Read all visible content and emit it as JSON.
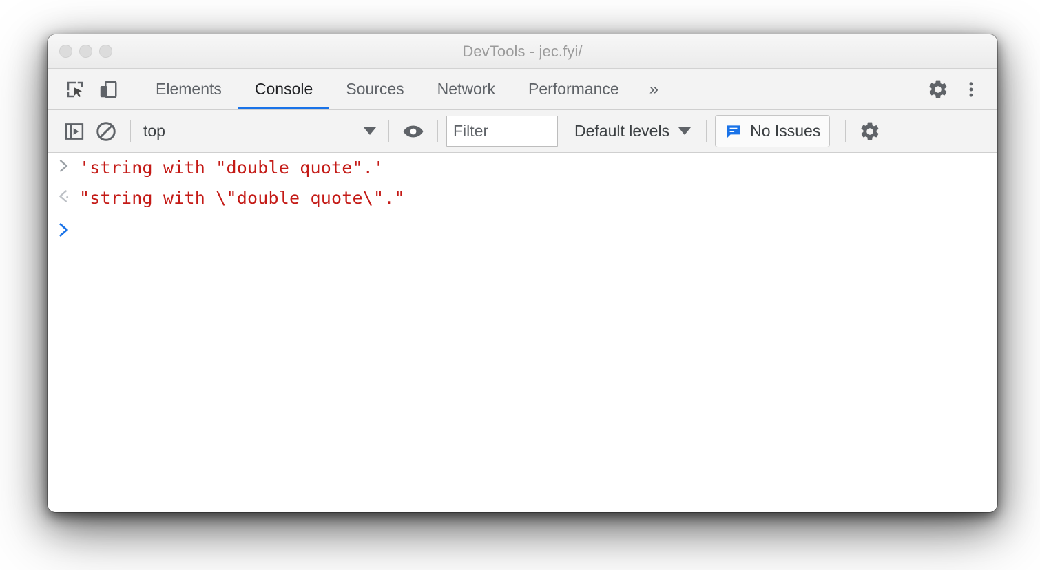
{
  "window": {
    "title": "DevTools - jec.fyi/",
    "traffic_lights": [
      "close-button",
      "minimize-button",
      "maximize-button"
    ]
  },
  "tabbar": {
    "inspect_icon": "inspect-element-icon",
    "device_icon": "device-toolbar-icon",
    "tabs": [
      {
        "label": "Elements",
        "active": false
      },
      {
        "label": "Console",
        "active": true
      },
      {
        "label": "Sources",
        "active": false
      },
      {
        "label": "Network",
        "active": false
      },
      {
        "label": "Performance",
        "active": false
      }
    ],
    "overflow_label": "»",
    "settings_icon": "gear-icon",
    "more_icon": "more-vertical-icon",
    "accent_color": "#1a73e8"
  },
  "console_toolbar": {
    "sidebar_icon": "console-sidebar-icon",
    "clear_icon": "clear-console-icon",
    "context": {
      "label": "top",
      "caret_icon": "chevron-down-icon"
    },
    "eye_icon": "live-expression-eye-icon",
    "filter": {
      "value": "",
      "placeholder": "Filter"
    },
    "levels": {
      "label": "Default levels",
      "caret_icon": "chevron-down-icon"
    },
    "issues": {
      "label": "No Issues",
      "icon": "issues-bubble-icon",
      "icon_color": "#1a73e8"
    },
    "settings_icon": "gear-icon"
  },
  "console": {
    "text_color": "#c41a16",
    "prompt_color": "#1a73e8",
    "messages": [
      {
        "kind": "input",
        "gutter_icon": "input-chevron-icon",
        "text": "'string with \"double quote\".'"
      },
      {
        "kind": "output",
        "gutter_icon": "output-chevron-icon",
        "text": "\"string with \\\"double quote\\\".\""
      }
    ],
    "prompt": {
      "gutter_icon": "prompt-chevron-icon",
      "value": ""
    }
  }
}
